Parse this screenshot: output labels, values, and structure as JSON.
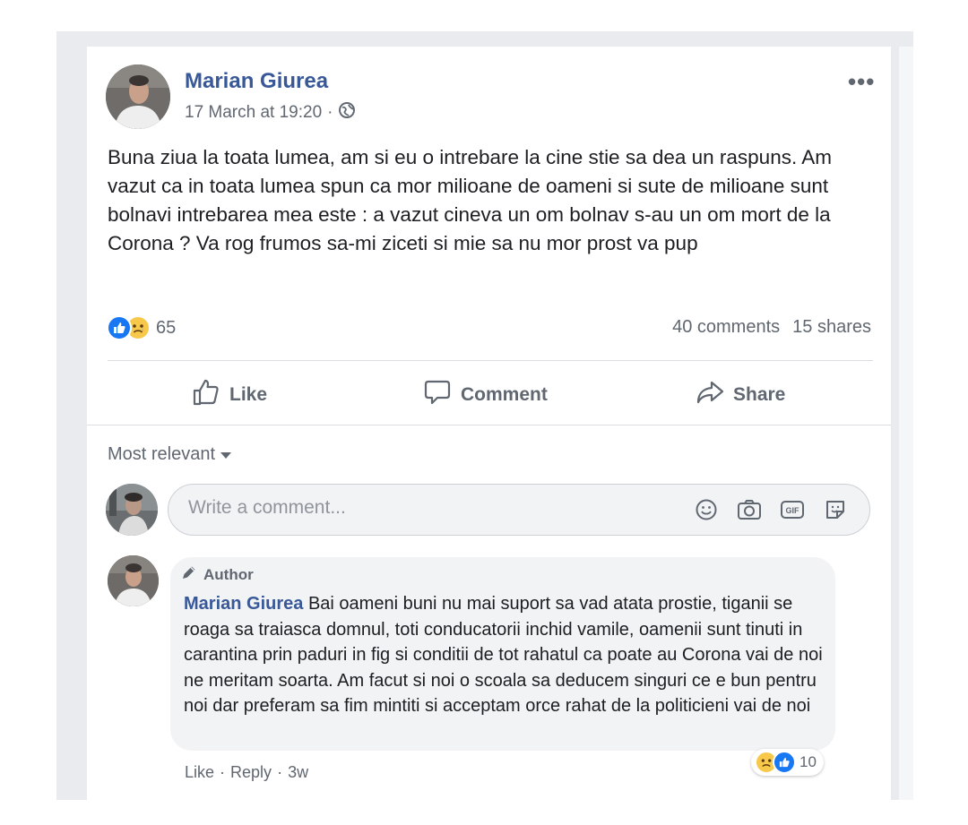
{
  "post": {
    "author": "Marian Giurea",
    "timestamp": "17 March at 19:20",
    "separator": "·",
    "privacy_icon": "globe-icon",
    "more_label": "•••",
    "text": "Buna ziua la toata lumea, am si eu o intrebare la cine stie sa dea un raspuns. Am vazut ca in toata lumea spun ca mor milioane de oameni si sute de milioane sunt bolnavi intrebarea mea este : a vazut cineva un om bolnav s-au un om mort de la Corona ? Va rog frumos sa-mi ziceti si mie sa nu mor prost va pup",
    "reaction_count": "65",
    "comments_count": "40 comments",
    "shares_count": "15 shares"
  },
  "actions": {
    "like": "Like",
    "comment": "Comment",
    "share": "Share"
  },
  "comments_section": {
    "sort_label": "Most relevant",
    "composer_placeholder": "Write a comment..."
  },
  "comment": {
    "badge": "Author",
    "author": "Marian Giurea",
    "text": "Bai oameni buni nu mai suport sa vad atata prostie, tiganii se roaga sa traiasca domnul, toti conducatorii inchid vamile, oamenii sunt tinuti in carantina prin paduri in fig si conditii de tot rahatul ca poate au Corona vai de noi ne meritam soarta. Am facut si noi o scoala sa deducem singuri ce e bun pentru noi dar preferam sa fim mintiti si acceptam orce rahat de la politicieni vai de noi",
    "reaction_count": "10",
    "like_label": "Like",
    "reply_label": "Reply",
    "age": "3w",
    "dot": "·"
  },
  "colors": {
    "link_blue": "#385898",
    "like_blue": "#1877f2",
    "sad_yellow": "#f7c84a",
    "secondary_text": "#606770",
    "bubble_bg": "#f2f3f5"
  }
}
